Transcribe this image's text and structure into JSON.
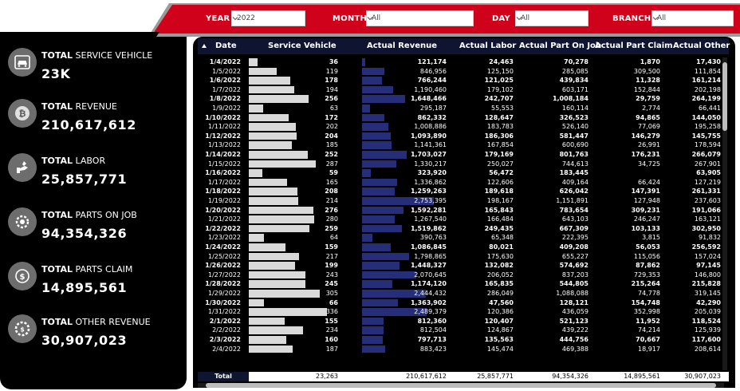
{
  "filters": [
    {
      "label": "YEAR",
      "value": "2022"
    },
    {
      "label": "MONTH",
      "value": "All"
    },
    {
      "label": "DAY",
      "value": "All"
    },
    {
      "label": "BRANCH",
      "value": "All"
    }
  ],
  "colors": {
    "accent_red": "#d0021b",
    "panel_black": "#000000",
    "header_navy": "#0f1430",
    "revenue_bar": "#262e7a",
    "vehicle_bar": "#d9d9d9"
  },
  "kpis": [
    {
      "title_bold": "TOTAL",
      "title_rest": " SERVICE VEHICLE",
      "value": "23K",
      "icon": "car-icon"
    },
    {
      "title_bold": "TOTAL",
      "title_rest": " REVENUE",
      "value": "210,617,612",
      "icon": "bitcoin-coin-icon"
    },
    {
      "title_bold": "TOTAL",
      "title_rest": " LABOR",
      "value": "25,857,771",
      "icon": "wrench-hand-icon"
    },
    {
      "title_bold": "TOTAL",
      "title_rest": " PARTS ON JOB",
      "value": "94,354,326",
      "icon": "gear-parts-icon"
    },
    {
      "title_bold": "TOTAL",
      "title_rest": " PARTS CLAIM",
      "value": "14,895,561",
      "icon": "dollar-refresh-icon"
    },
    {
      "title_bold": "TOTAL",
      "title_rest": " OTHER REVENUE",
      "value": "30,907,023",
      "icon": "gear-dollar-icon"
    }
  ],
  "table": {
    "columns": [
      "Date",
      "Service Vehicle",
      "Actual Revenue",
      "Actual Labor",
      "Actual Part On Job",
      "Actual Part Claim",
      "Actual Other"
    ],
    "rows": [
      {
        "date": "1/4/2022",
        "sv": 36,
        "rev": 121174,
        "rev_s": "121,174",
        "lab": "24,463",
        "poj": "70,278",
        "pcl": "1,870",
        "oth": "17,430",
        "bold": true
      },
      {
        "date": "1/5/2022",
        "sv": 119,
        "rev": 846956,
        "rev_s": "846,956",
        "lab": "125,150",
        "poj": "285,085",
        "pcl": "309,500",
        "oth": "111,854",
        "bold": false
      },
      {
        "date": "1/6/2022",
        "sv": 178,
        "rev": 766244,
        "rev_s": "766,244",
        "lab": "121,025",
        "poj": "439,834",
        "pcl": "11,328",
        "oth": "161,214",
        "bold": true
      },
      {
        "date": "1/7/2022",
        "sv": 194,
        "rev": 1190460,
        "rev_s": "1,190,460",
        "lab": "179,102",
        "poj": "603,171",
        "pcl": "152,844",
        "oth": "202,198",
        "bold": false
      },
      {
        "date": "1/8/2022",
        "sv": 256,
        "rev": 1648466,
        "rev_s": "1,648,466",
        "lab": "242,707",
        "poj": "1,008,184",
        "pcl": "29,759",
        "oth": "264,199",
        "bold": true
      },
      {
        "date": "1/9/2022",
        "sv": 63,
        "rev": 295187,
        "rev_s": "295,187",
        "lab": "55,553",
        "poj": "160,114",
        "pcl": "2,774",
        "oth": "66,441",
        "bold": false
      },
      {
        "date": "1/10/2022",
        "sv": 172,
        "rev": 862332,
        "rev_s": "862,332",
        "lab": "128,647",
        "poj": "326,523",
        "pcl": "94,865",
        "oth": "144,050",
        "bold": true
      },
      {
        "date": "1/11/2022",
        "sv": 202,
        "rev": 1008886,
        "rev_s": "1,008,886",
        "lab": "183,783",
        "poj": "526,140",
        "pcl": "77,069",
        "oth": "195,258",
        "bold": false
      },
      {
        "date": "1/12/2022",
        "sv": 204,
        "rev": 1093890,
        "rev_s": "1,093,890",
        "lab": "186,306",
        "poj": "581,447",
        "pcl": "146,279",
        "oth": "145,755",
        "bold": true
      },
      {
        "date": "1/13/2022",
        "sv": 185,
        "rev": 1141361,
        "rev_s": "1,141,361",
        "lab": "167,854",
        "poj": "600,690",
        "pcl": "26,991",
        "oth": "178,594",
        "bold": false
      },
      {
        "date": "1/14/2022",
        "sv": 252,
        "rev": 1703027,
        "rev_s": "1,703,027",
        "lab": "179,169",
        "poj": "801,763",
        "pcl": "176,231",
        "oth": "266,079",
        "bold": true
      },
      {
        "date": "1/15/2022",
        "sv": 287,
        "rev": 1330217,
        "rev_s": "1,330,217",
        "lab": "250,027",
        "poj": "744,613",
        "pcl": "34,725",
        "oth": "267,901",
        "bold": false
      },
      {
        "date": "1/16/2022",
        "sv": 59,
        "rev": 323920,
        "rev_s": "323,920",
        "lab": "56,472",
        "poj": "183,445",
        "pcl": "",
        "oth": "63,905",
        "bold": true
      },
      {
        "date": "1/17/2022",
        "sv": 165,
        "rev": 1336862,
        "rev_s": "1,336,862",
        "lab": "122,606",
        "poj": "409,164",
        "pcl": "66,424",
        "oth": "127,219",
        "bold": false
      },
      {
        "date": "1/18/2022",
        "sv": 208,
        "rev": 1259263,
        "rev_s": "1,259,263",
        "lab": "189,618",
        "poj": "626,042",
        "pcl": "147,391",
        "oth": "261,331",
        "bold": true
      },
      {
        "date": "1/19/2022",
        "sv": 214,
        "rev": 2753395,
        "rev_s": "2,753,395",
        "lab": "198,167",
        "poj": "1,151,891",
        "pcl": "127,948",
        "oth": "237,603",
        "bold": false
      },
      {
        "date": "1/20/2022",
        "sv": 276,
        "rev": 1592281,
        "rev_s": "1,592,281",
        "lab": "165,843",
        "poj": "783,654",
        "pcl": "309,231",
        "oth": "191,066",
        "bold": true
      },
      {
        "date": "1/21/2022",
        "sv": 280,
        "rev": 1267540,
        "rev_s": "1,267,540",
        "lab": "166,484",
        "poj": "643,103",
        "pcl": "246,247",
        "oth": "163,121",
        "bold": false
      },
      {
        "date": "1/22/2022",
        "sv": 259,
        "rev": 1519862,
        "rev_s": "1,519,862",
        "lab": "249,435",
        "poj": "667,309",
        "pcl": "103,133",
        "oth": "302,950",
        "bold": true
      },
      {
        "date": "1/23/2022",
        "sv": 64,
        "rev": 390763,
        "rev_s": "390,763",
        "lab": "65,348",
        "poj": "222,395",
        "pcl": "3,815",
        "oth": "91,832",
        "bold": false
      },
      {
        "date": "1/24/2022",
        "sv": 159,
        "rev": 1086845,
        "rev_s": "1,086,845",
        "lab": "80,021",
        "poj": "409,208",
        "pcl": "56,053",
        "oth": "256,592",
        "bold": true
      },
      {
        "date": "1/25/2022",
        "sv": 217,
        "rev": 1798865,
        "rev_s": "1,798,865",
        "lab": "175,630",
        "poj": "655,227",
        "pcl": "115,056",
        "oth": "157,024",
        "bold": false
      },
      {
        "date": "1/26/2022",
        "sv": 199,
        "rev": 1448327,
        "rev_s": "1,448,327",
        "lab": "132,082",
        "poj": "574,692",
        "pcl": "87,862",
        "oth": "97,145",
        "bold": true
      },
      {
        "date": "1/27/2022",
        "sv": 243,
        "rev": 2070645,
        "rev_s": "2,070,645",
        "lab": "206,052",
        "poj": "837,203",
        "pcl": "729,353",
        "oth": "146,800",
        "bold": false
      },
      {
        "date": "1/28/2022",
        "sv": 245,
        "rev": 1174120,
        "rev_s": "1,174,120",
        "lab": "165,835",
        "poj": "544,805",
        "pcl": "215,264",
        "oth": "215,828",
        "bold": true
      },
      {
        "date": "1/29/2022",
        "sv": 305,
        "rev": 2444432,
        "rev_s": "2,444,432",
        "lab": "286,049",
        "poj": "1,088,088",
        "pcl": "74,778",
        "oth": "319,145",
        "bold": false
      },
      {
        "date": "1/30/2022",
        "sv": 66,
        "rev": 1363902,
        "rev_s": "1,363,902",
        "lab": "47,560",
        "poj": "128,121",
        "pcl": "154,748",
        "oth": "42,290",
        "bold": true
      },
      {
        "date": "1/31/2022",
        "sv": 336,
        "rev": 2489379,
        "rev_s": "2,489,379",
        "lab": "120,386",
        "poj": "436,059",
        "pcl": "352,998",
        "oth": "205,039",
        "bold": false
      },
      {
        "date": "2/1/2022",
        "sv": 155,
        "rev": 812360,
        "rev_s": "812,360",
        "lab": "120,407",
        "poj": "521,123",
        "pcl": "11,952",
        "oth": "118,524",
        "bold": true
      },
      {
        "date": "2/2/2022",
        "sv": 234,
        "rev": 812504,
        "rev_s": "812,504",
        "lab": "124,867",
        "poj": "439,222",
        "pcl": "74,214",
        "oth": "125,939",
        "bold": false
      },
      {
        "date": "2/3/2022",
        "sv": 160,
        "rev": 797713,
        "rev_s": "797,713",
        "lab": "135,563",
        "poj": "444,756",
        "pcl": "70,667",
        "oth": "117,600",
        "bold": true
      },
      {
        "date": "2/4/2022",
        "sv": 187,
        "rev": 883423,
        "rev_s": "883,423",
        "lab": "145,474",
        "poj": "469,388",
        "pcl": "18,917",
        "oth": "208,614",
        "bold": false
      }
    ],
    "total": {
      "label": "Total",
      "sv": "23,263",
      "rev": "210,617,612",
      "lab": "25,857,771",
      "poj": "94,354,326",
      "pcl": "14,895,561",
      "oth": "30,907,023"
    }
  }
}
